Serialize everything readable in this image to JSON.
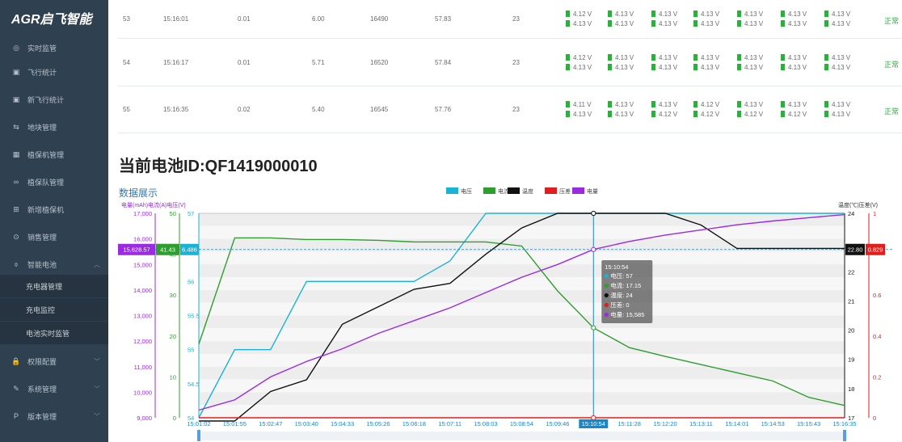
{
  "sidebar": {
    "logo": "AGR启飞智能",
    "items": [
      {
        "icon": "monitor-icon",
        "glyph": "◎",
        "label": "实时监管"
      },
      {
        "icon": "chart-icon",
        "glyph": "▣",
        "label": "飞行统计"
      },
      {
        "icon": "chart-icon",
        "glyph": "▣",
        "label": "新飞行统计"
      },
      {
        "icon": "map-icon",
        "glyph": "⇆",
        "label": "地块管理"
      },
      {
        "icon": "grid-icon",
        "glyph": "▦",
        "label": "植保机管理"
      },
      {
        "icon": "team-icon",
        "glyph": "∞",
        "label": "植保队管理"
      },
      {
        "icon": "add-icon",
        "glyph": "⊞",
        "label": "新增植保机"
      },
      {
        "icon": "sales-icon",
        "glyph": "⊙",
        "label": "销售管理"
      },
      {
        "icon": "battery-icon",
        "glyph": "⌽",
        "label": "智能电池"
      }
    ],
    "subitems": [
      "充电器管理",
      "充电监控",
      "电池实时监管"
    ],
    "items2": [
      {
        "icon": "lock-icon",
        "glyph": "🔒",
        "label": "权限配置"
      },
      {
        "icon": "wrench-icon",
        "glyph": "✎",
        "label": "系统管理"
      },
      {
        "icon": "version-icon",
        "glyph": "P",
        "label": "版本管理"
      }
    ]
  },
  "rows": [
    {
      "no": "53",
      "time": "15:16:01",
      "a": "0.01",
      "b": "6.00",
      "c": "16490",
      "d": "57.83",
      "e": "23",
      "v1": [
        "4.12 V",
        "4.13 V",
        "4.13 V",
        "4.13 V",
        "4.13 V",
        "4.13 V",
        "4.13 V"
      ],
      "v2": [
        "4.13 V",
        "4.13 V",
        "4.13 V",
        "4.13 V",
        "4.13 V",
        "4.13 V",
        "4.13 V"
      ],
      "status": "正常"
    },
    {
      "no": "54",
      "time": "15:16:17",
      "a": "0.01",
      "b": "5.71",
      "c": "16520",
      "d": "57.84",
      "e": "23",
      "v1": [
        "4.12 V",
        "4.13 V",
        "4.13 V",
        "4.13 V",
        "4.13 V",
        "4.13 V",
        "4.13 V"
      ],
      "v2": [
        "4.13 V",
        "4.13 V",
        "4.13 V",
        "4.13 V",
        "4.13 V",
        "4.13 V",
        "4.13 V"
      ],
      "status": "正常"
    },
    {
      "no": "55",
      "time": "15:16:35",
      "a": "0.02",
      "b": "5.40",
      "c": "16545",
      "d": "57.76",
      "e": "23",
      "v1": [
        "4.11 V",
        "4.13 V",
        "4.13 V",
        "4.12 V",
        "4.13 V",
        "4.13 V",
        "4.13 V"
      ],
      "v2": [
        "4.13 V",
        "4.13 V",
        "4.12 V",
        "4.12 V",
        "4.12 V",
        "4.12 V",
        "4.13 V"
      ],
      "status": "正常"
    }
  ],
  "battery_title": "当前电池ID:QF1419000010",
  "section_label": "数据展示",
  "colors": {
    "voltage": "#1ab3d6",
    "current": "#2e9e2e",
    "temp": "#111111",
    "pressure": "#e01e1e",
    "capacity": "#9a2be2",
    "accent": "#1a86c6"
  },
  "chart_data": {
    "type": "line",
    "legend": [
      "电压",
      "电流",
      "温度",
      "压差",
      "电量"
    ],
    "axis_titles": {
      "left": "电量(mAh)电流(A)电压(V)",
      "right": "温度(℃)压差(V)"
    },
    "x": [
      "15:01:02",
      "15:01:55",
      "15:02:47",
      "15:03:40",
      "15:04:33",
      "15:05:26",
      "15:06:18",
      "15:07:11",
      "15:08:03",
      "15:08:54",
      "15:09:46",
      "15:10:54",
      "15:11:28",
      "15:12:20",
      "15:13:11",
      "15:14:01",
      "15:14:53",
      "15:15:43",
      "15:16:35"
    ],
    "ylim_capacity": [
      9000,
      17000
    ],
    "capacity_ticks": [
      "17,000",
      "16,000",
      "15,000",
      "14,000",
      "13,000",
      "12,000",
      "11,000",
      "10,000",
      "9,000"
    ],
    "ylim_current": [
      0,
      50
    ],
    "current_ticks": [
      "50",
      "40",
      "30",
      "20",
      "10",
      "0"
    ],
    "ylim_voltage": [
      54,
      57
    ],
    "voltage_ticks": [
      "57",
      "56",
      "55.5",
      "55",
      "54.5",
      "54"
    ],
    "ylim_temp": [
      17,
      24
    ],
    "temp_ticks": [
      "24",
      "22",
      "21",
      "20",
      "19",
      "18",
      "17"
    ],
    "ylim_pressure": [
      0,
      1
    ],
    "pressure_ticks": [
      "1",
      "0.6",
      "0.4",
      "0.2",
      "0"
    ],
    "series": [
      {
        "name": "电压",
        "values": [
          54.0,
          55.0,
          55.0,
          56.0,
          56.0,
          56.0,
          56.0,
          56.3,
          57.0,
          57.0,
          57.0,
          57.0,
          57.0,
          57.0,
          57.0,
          57.0,
          57.0,
          57.0,
          57.0
        ]
      },
      {
        "name": "电流",
        "values": [
          18,
          44,
          44,
          43.6,
          43.6,
          43.4,
          43.0,
          43.0,
          43.0,
          42.0,
          31.0,
          22.0,
          17.15,
          15.0,
          13.0,
          11.0,
          9.0,
          5.0,
          3.0
        ]
      },
      {
        "name": "温度",
        "values": [
          16.5,
          16.8,
          17.9,
          18.3,
          20.2,
          20.8,
          21.4,
          21.6,
          22.6,
          23.5,
          24.0,
          24.0,
          24.0,
          24.0,
          23.6,
          22.8,
          22.8,
          22.8,
          22.8
        ]
      },
      {
        "name": "压差",
        "values": [
          0,
          0,
          0,
          0,
          0,
          0,
          0,
          0,
          0,
          0,
          0,
          0,
          0,
          0,
          0,
          0,
          0,
          0,
          0
        ]
      },
      {
        "name": "电量",
        "values": [
          9300,
          9700,
          10600,
          11200,
          11700,
          12300,
          12800,
          13300,
          13900,
          14500,
          15000,
          15585,
          15900,
          16150,
          16350,
          16550,
          16700,
          16830,
          16950
        ]
      }
    ],
    "crosshair": {
      "time": "15:10:54",
      "left_readout": [
        "15,628.57",
        "41.43",
        "6.486"
      ],
      "right_readout": [
        "22.80",
        "0.829"
      ]
    },
    "tooltip": {
      "time": "15:10:54",
      "lines": [
        "电压: 57",
        "电流: 17.15",
        "温度: 24",
        "压差: 0",
        "电量: 15,585"
      ]
    }
  }
}
